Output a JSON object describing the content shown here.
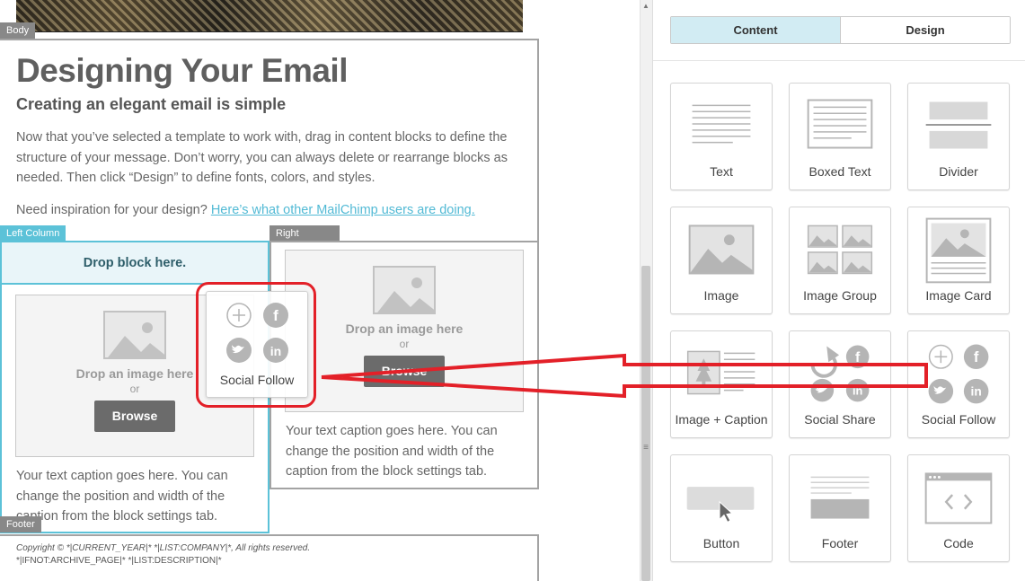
{
  "canvas": {
    "tags": {
      "body": "Body",
      "left_column": "Left Column",
      "right_column": "Right Column",
      "footer": "Footer"
    },
    "heading": "Designing Your Email",
    "subheading": "Creating an elegant email is simple",
    "paragraph": "Now that you’ve selected a template to work with, drag in content blocks to define the structure of your message. Don’t worry, you can always delete or rearrange blocks as needed. Then click “Design” to define fonts, colors, and styles.",
    "inspiration_prefix": "Need inspiration for your design? ",
    "inspiration_link": "Here’s what other MailChimp users are doing.",
    "drop_block": "Drop block here.",
    "image_drop_label": "Drop an image here",
    "or_label": "or",
    "browse_label": "Browse",
    "caption": "Your text caption goes here. You can change the position and width of the caption from the block settings tab.",
    "footer_line1": "Copyright © *|CURRENT_YEAR|* *|LIST:COMPANY|*, All rights reserved.",
    "footer_line2": "*|IFNOT:ARCHIVE_PAGE|* *|LIST:DESCRIPTION|*",
    "drag_ghost_label": "Social Follow"
  },
  "panel": {
    "tabs": [
      {
        "label": "Content",
        "active": true
      },
      {
        "label": "Design",
        "active": false
      }
    ],
    "blocks": [
      {
        "label": "Text",
        "icon": "text-block-icon"
      },
      {
        "label": "Boxed Text",
        "icon": "boxed-text-block-icon"
      },
      {
        "label": "Divider",
        "icon": "divider-block-icon"
      },
      {
        "label": "Image",
        "icon": "image-block-icon"
      },
      {
        "label": "Image Group",
        "icon": "image-group-block-icon"
      },
      {
        "label": "Image Card",
        "icon": "image-card-block-icon"
      },
      {
        "label": "Image + Caption",
        "icon": "image-caption-block-icon"
      },
      {
        "label": "Social Share",
        "icon": "social-share-block-icon"
      },
      {
        "label": "Social Follow",
        "icon": "social-follow-block-icon"
      },
      {
        "label": "Button",
        "icon": "button-block-icon"
      },
      {
        "label": "Footer",
        "icon": "footer-block-icon"
      },
      {
        "label": "Code",
        "icon": "code-block-icon"
      }
    ]
  },
  "colors": {
    "accent": "#5cc2d8",
    "annotation": "#e32028",
    "tab_active": "#d2ecf3",
    "button": "#6b6b6b",
    "icon_gray": "#b5b5b5"
  }
}
